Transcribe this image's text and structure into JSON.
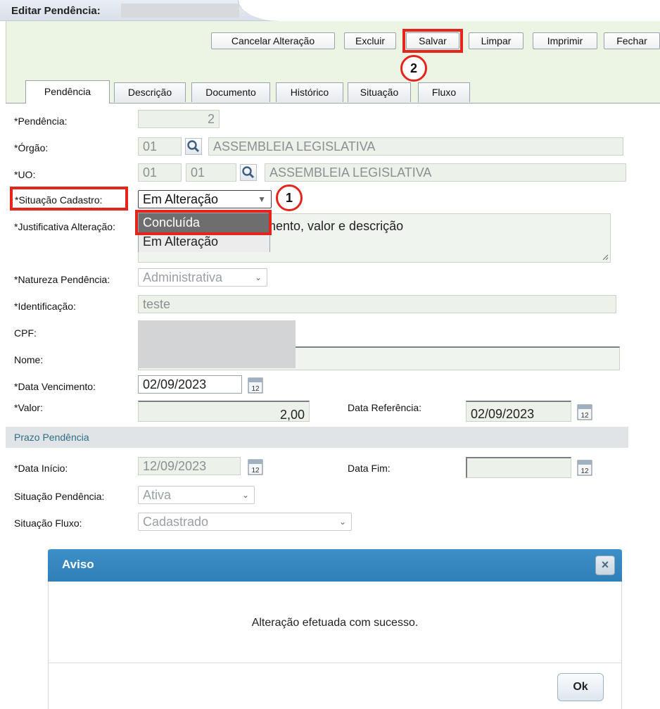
{
  "header": {
    "title": "Editar Pendência:"
  },
  "toolbar": {
    "cancel_label": "Cancelar Alteração",
    "delete_label": "Excluir",
    "save_label": "Salvar",
    "clear_label": "Limpar",
    "print_label": "Imprimir",
    "close_label": "Fechar"
  },
  "annotations": {
    "step1": "1",
    "step2": "2",
    "highlight_color": "#e5251b"
  },
  "tabs": [
    {
      "label": "Pendência",
      "active": true
    },
    {
      "label": "Descrição"
    },
    {
      "label": "Documento"
    },
    {
      "label": "Histórico"
    },
    {
      "label": "Situação"
    },
    {
      "label": "Fluxo"
    }
  ],
  "form": {
    "pendencia": {
      "label": "*Pendência:",
      "value": "2"
    },
    "orgao": {
      "label": "*Órgão:",
      "code": "01",
      "name": "ASSEMBLEIA LEGISLATIVA"
    },
    "uo": {
      "label": "*UO:",
      "code1": "01",
      "code2": "01",
      "name": "ASSEMBLEIA LEGISLATIVA"
    },
    "situacao_cadastro": {
      "label": "*Situação Cadastro:",
      "value": "Em Alteração",
      "options": [
        "Concluída",
        "Em Alteração"
      ]
    },
    "justificativa": {
      "label": "*Justificativa Alteração:",
      "value": "mento, valor e descrição"
    },
    "natureza": {
      "label": "*Natureza Pendência:",
      "value": "Administrativa"
    },
    "identificacao": {
      "label": "*Identificação:",
      "value": "teste"
    },
    "cpf": {
      "label": "CPF:"
    },
    "nome": {
      "label": "Nome:"
    },
    "data_vencimento": {
      "label": "*Data Vencimento:",
      "value": "02/09/2023"
    },
    "valor": {
      "label": "*Valor:",
      "value": "2,00"
    },
    "data_referencia": {
      "label": "Data Referência:",
      "value": "02/09/2023"
    },
    "prazo_section": "Prazo Pendência",
    "data_inicio": {
      "label": "*Data Início:",
      "value": "12/09/2023"
    },
    "data_fim": {
      "label": "Data Fim:",
      "value": ""
    },
    "situacao_pendencia": {
      "label": "Situação Pendência:",
      "value": "Ativa"
    },
    "situacao_fluxo": {
      "label": "Situação Fluxo:",
      "value": "Cadastrado"
    }
  },
  "dialog": {
    "title": "Aviso",
    "close": "×",
    "message": "Alteração efetuada com sucesso.",
    "ok_label": "Ok"
  },
  "calendar_icon_text": "12",
  "colors": {
    "toolbar_bg": "#ecf4e4",
    "dialog_header": "#2f7fb8",
    "field_bg": "#ecf2ea"
  }
}
